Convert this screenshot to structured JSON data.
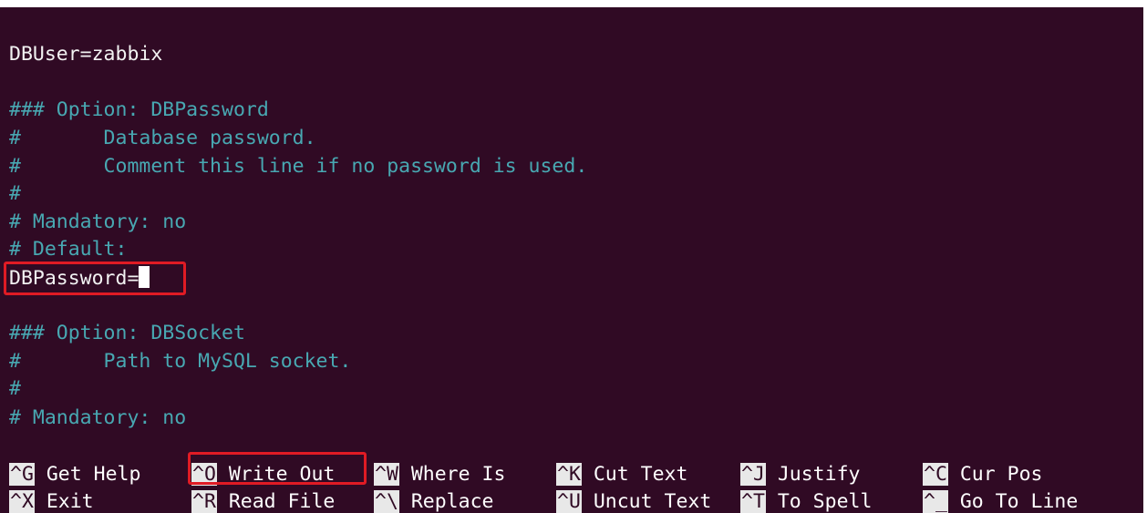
{
  "editor": {
    "lines": [
      {
        "text": "DBUser=zabbix",
        "style": "w"
      },
      {
        "text": "",
        "style": "w"
      },
      {
        "text": "### Option: DBPassword",
        "style": "c"
      },
      {
        "text": "#       Database password.",
        "style": "c"
      },
      {
        "text": "#       Comment this line if no password is used.",
        "style": "c"
      },
      {
        "text": "#",
        "style": "c"
      },
      {
        "text": "# Mandatory: no",
        "style": "c"
      },
      {
        "text": "# Default:",
        "style": "c"
      },
      {
        "text": "DBPassword=",
        "style": "w",
        "cursor": true
      },
      {
        "text": "",
        "style": "w"
      },
      {
        "text": "### Option: DBSocket",
        "style": "c"
      },
      {
        "text": "#       Path to MySQL socket.",
        "style": "c"
      },
      {
        "text": "#",
        "style": "c"
      },
      {
        "text": "# Mandatory: no",
        "style": "c"
      }
    ]
  },
  "shortcuts": {
    "row1": [
      {
        "key": "^G",
        "label": "Get Help"
      },
      {
        "key": "^O",
        "label": "Write Out"
      },
      {
        "key": "^W",
        "label": "Where Is"
      },
      {
        "key": "^K",
        "label": "Cut Text"
      },
      {
        "key": "^J",
        "label": "Justify"
      },
      {
        "key": "^C",
        "label": "Cur Pos"
      }
    ],
    "row2": [
      {
        "key": "^X",
        "label": "Exit"
      },
      {
        "key": "^R",
        "label": "Read File"
      },
      {
        "key": "^\\",
        "label": "Replace"
      },
      {
        "key": "^U",
        "label": "Uncut Text"
      },
      {
        "key": "^T",
        "label": "To Spell"
      },
      {
        "key": "^_",
        "label": "Go To Line"
      }
    ]
  },
  "colors": {
    "background": "#300a24",
    "comment": "#48a8b2",
    "highlight_box": "#e01b24"
  }
}
